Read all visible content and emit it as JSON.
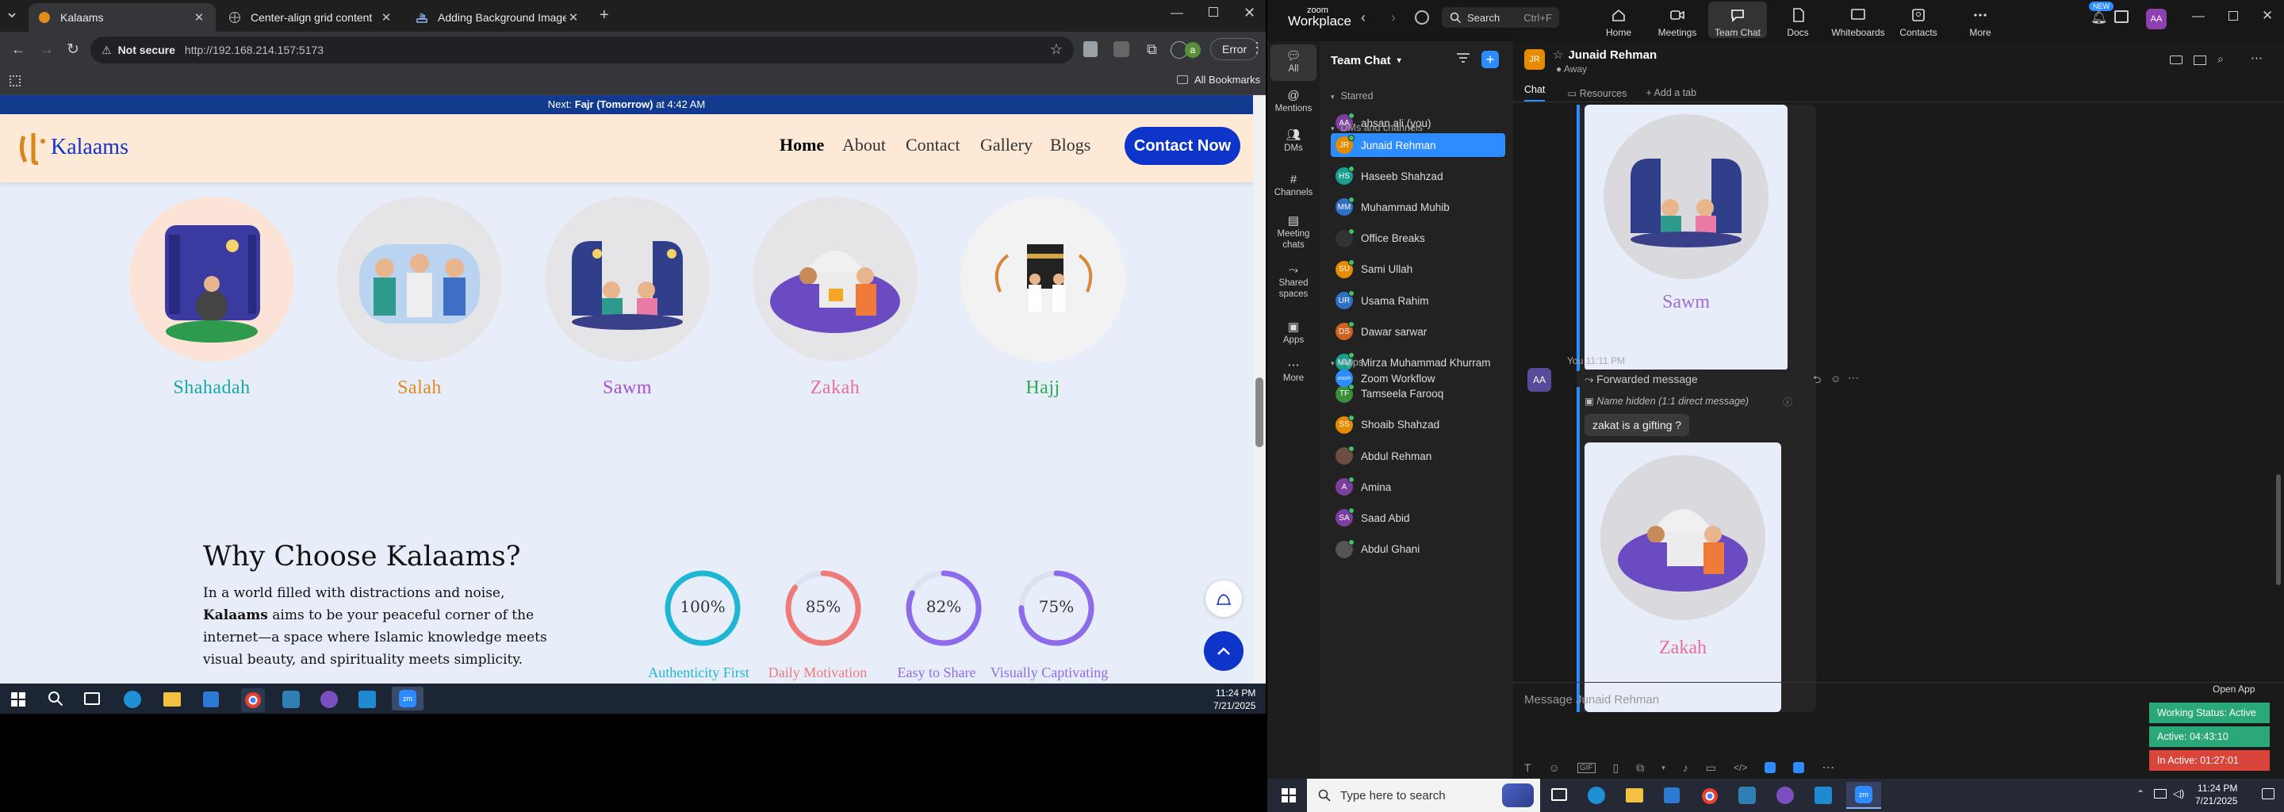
{
  "browser": {
    "tabs": [
      {
        "title": "Kalaams"
      },
      {
        "title": "Center-align grid content"
      },
      {
        "title": "Adding Background Image to F"
      }
    ],
    "address": {
      "security_label": "Not secure",
      "url": "http://192.168.214.157:5173"
    },
    "profile_letter": "a",
    "error_label": "Error",
    "bookmarks_label": "All Bookmarks"
  },
  "site": {
    "prayer_banner": {
      "prefix": "Next: ",
      "prayer": "Fajr (Tomorrow)",
      "suffix": " at 4:42 AM"
    },
    "logo_text": "Kalaams",
    "nav": [
      "Home",
      "About",
      "Contact",
      "Gallery",
      "Blogs"
    ],
    "cta": "Contact Now",
    "pillars": [
      {
        "label": "Shahadah",
        "color": "#1aa6a6"
      },
      {
        "label": "Salah",
        "color": "#e38a1d"
      },
      {
        "label": "Sawm",
        "color": "#a24fd6"
      },
      {
        "label": "Zakah",
        "color": "#e86f96"
      },
      {
        "label": "Hajj",
        "color": "#32a853"
      }
    ],
    "why": {
      "heading": "Why Choose Kalaams?",
      "p1": "In a world filled with distractions and noise,",
      "brand": "Kalaams",
      "p2": " aims to be your peaceful corner of the internet—a space where Islamic knowledge meets visual beauty, and spirituality meets simplicity."
    },
    "stats": [
      {
        "value": "100%",
        "percent": 100,
        "label": "Authenticity First",
        "color": "#1fb6d6"
      },
      {
        "value": "85%",
        "percent": 85,
        "label": "Daily Motivation",
        "color": "#ef7a7a"
      },
      {
        "value": "82%",
        "percent": 82,
        "label": "Easy to Share",
        "color": "#8e6bea"
      },
      {
        "value": "75%",
        "percent": 75,
        "label": "Visually Captivating",
        "color": "#8e6bea"
      }
    ]
  },
  "left_taskbar": {
    "time": "11:24 PM",
    "date": "7/21/2025"
  },
  "zoom": {
    "brand_top": "zoom",
    "brand_bottom": "Workplace",
    "search_label": "Search",
    "search_shortcut": "Ctrl+F",
    "categories": [
      "Home",
      "Meetings",
      "Team Chat",
      "Docs",
      "Whiteboards",
      "Contacts",
      "More"
    ],
    "new_badge": "NEW",
    "user_initials": "AA",
    "rail": [
      "All",
      "Mentions",
      "DMs",
      "Channels",
      "Meeting chats",
      "Shared spaces",
      "Apps",
      "More"
    ],
    "panel_title": "Team Chat",
    "sections": {
      "starred": "Starred",
      "dms": "DMs and channels",
      "apps": "Apps"
    },
    "starred_user": {
      "initials": "AA",
      "name": "ahsan ali (you)",
      "color": "#7c3fa0"
    },
    "contacts": [
      {
        "initials": "JR",
        "name": "Junaid Rehman",
        "color": "#e68a00"
      },
      {
        "initials": "HS",
        "name": "Haseeb Shahzad",
        "color": "#1a9e8f"
      },
      {
        "initials": "MM",
        "name": "Muhammad Muhib",
        "color": "#2f6fc4"
      },
      {
        "initials": "",
        "name": "Office Breaks",
        "color": "#333333"
      },
      {
        "initials": "SU",
        "name": "Sami Ullah",
        "color": "#e68a00"
      },
      {
        "initials": "UR",
        "name": "Usama Rahim",
        "color": "#2f6fc4"
      },
      {
        "initials": "DS",
        "name": "Dawar sarwar",
        "color": "#d0621f"
      },
      {
        "initials": "MM",
        "name": "Mirza Muhammad Khurram",
        "color": "#1a9e8f"
      },
      {
        "initials": "TF",
        "name": "Tamseela Farooq",
        "color": "#3a8f3a"
      },
      {
        "initials": "SS",
        "name": "Shoaib Shahzad",
        "color": "#e68a00"
      },
      {
        "initials": "",
        "name": "Abdul Rehman",
        "color": "#6d4c41"
      },
      {
        "initials": "A",
        "name": "Amina",
        "color": "#7c3fa0"
      },
      {
        "initials": "SA",
        "name": "Saad Abid",
        "color": "#7c3fa0"
      },
      {
        "initials": "",
        "name": "Abdul Ghani",
        "color": "#555555"
      }
    ],
    "apps": [
      {
        "name": "Zoom Workflow",
        "icon_text": "zoom"
      }
    ],
    "header": {
      "initials": "JR",
      "name": "Junaid Rehman",
      "status": "Away"
    },
    "chat_tabs": [
      "Chat",
      "Resources",
      "Add a tab"
    ],
    "messages": {
      "first_caption": "Sawm",
      "meta": "You 11:11 PM",
      "forward_label": "Forwarded message",
      "hidden_label": "Name hidden (1:1 direct message)",
      "quote": "zakat is a gifting ?",
      "second_caption": "Zakah"
    },
    "compose_placeholder": "Message Junaid Rehman",
    "open_app": "Open App",
    "statuses": [
      {
        "text": "Working Status: Active",
        "color": "#2aa877"
      },
      {
        "text": "Active: 04:43:10",
        "color": "#2aa877"
      },
      {
        "text": "In Active: 01:27:01",
        "color": "#d9453a"
      }
    ]
  },
  "right_taskbar": {
    "search_placeholder": "Type here to search",
    "time": "11:24 PM",
    "date": "7/21/2025"
  }
}
